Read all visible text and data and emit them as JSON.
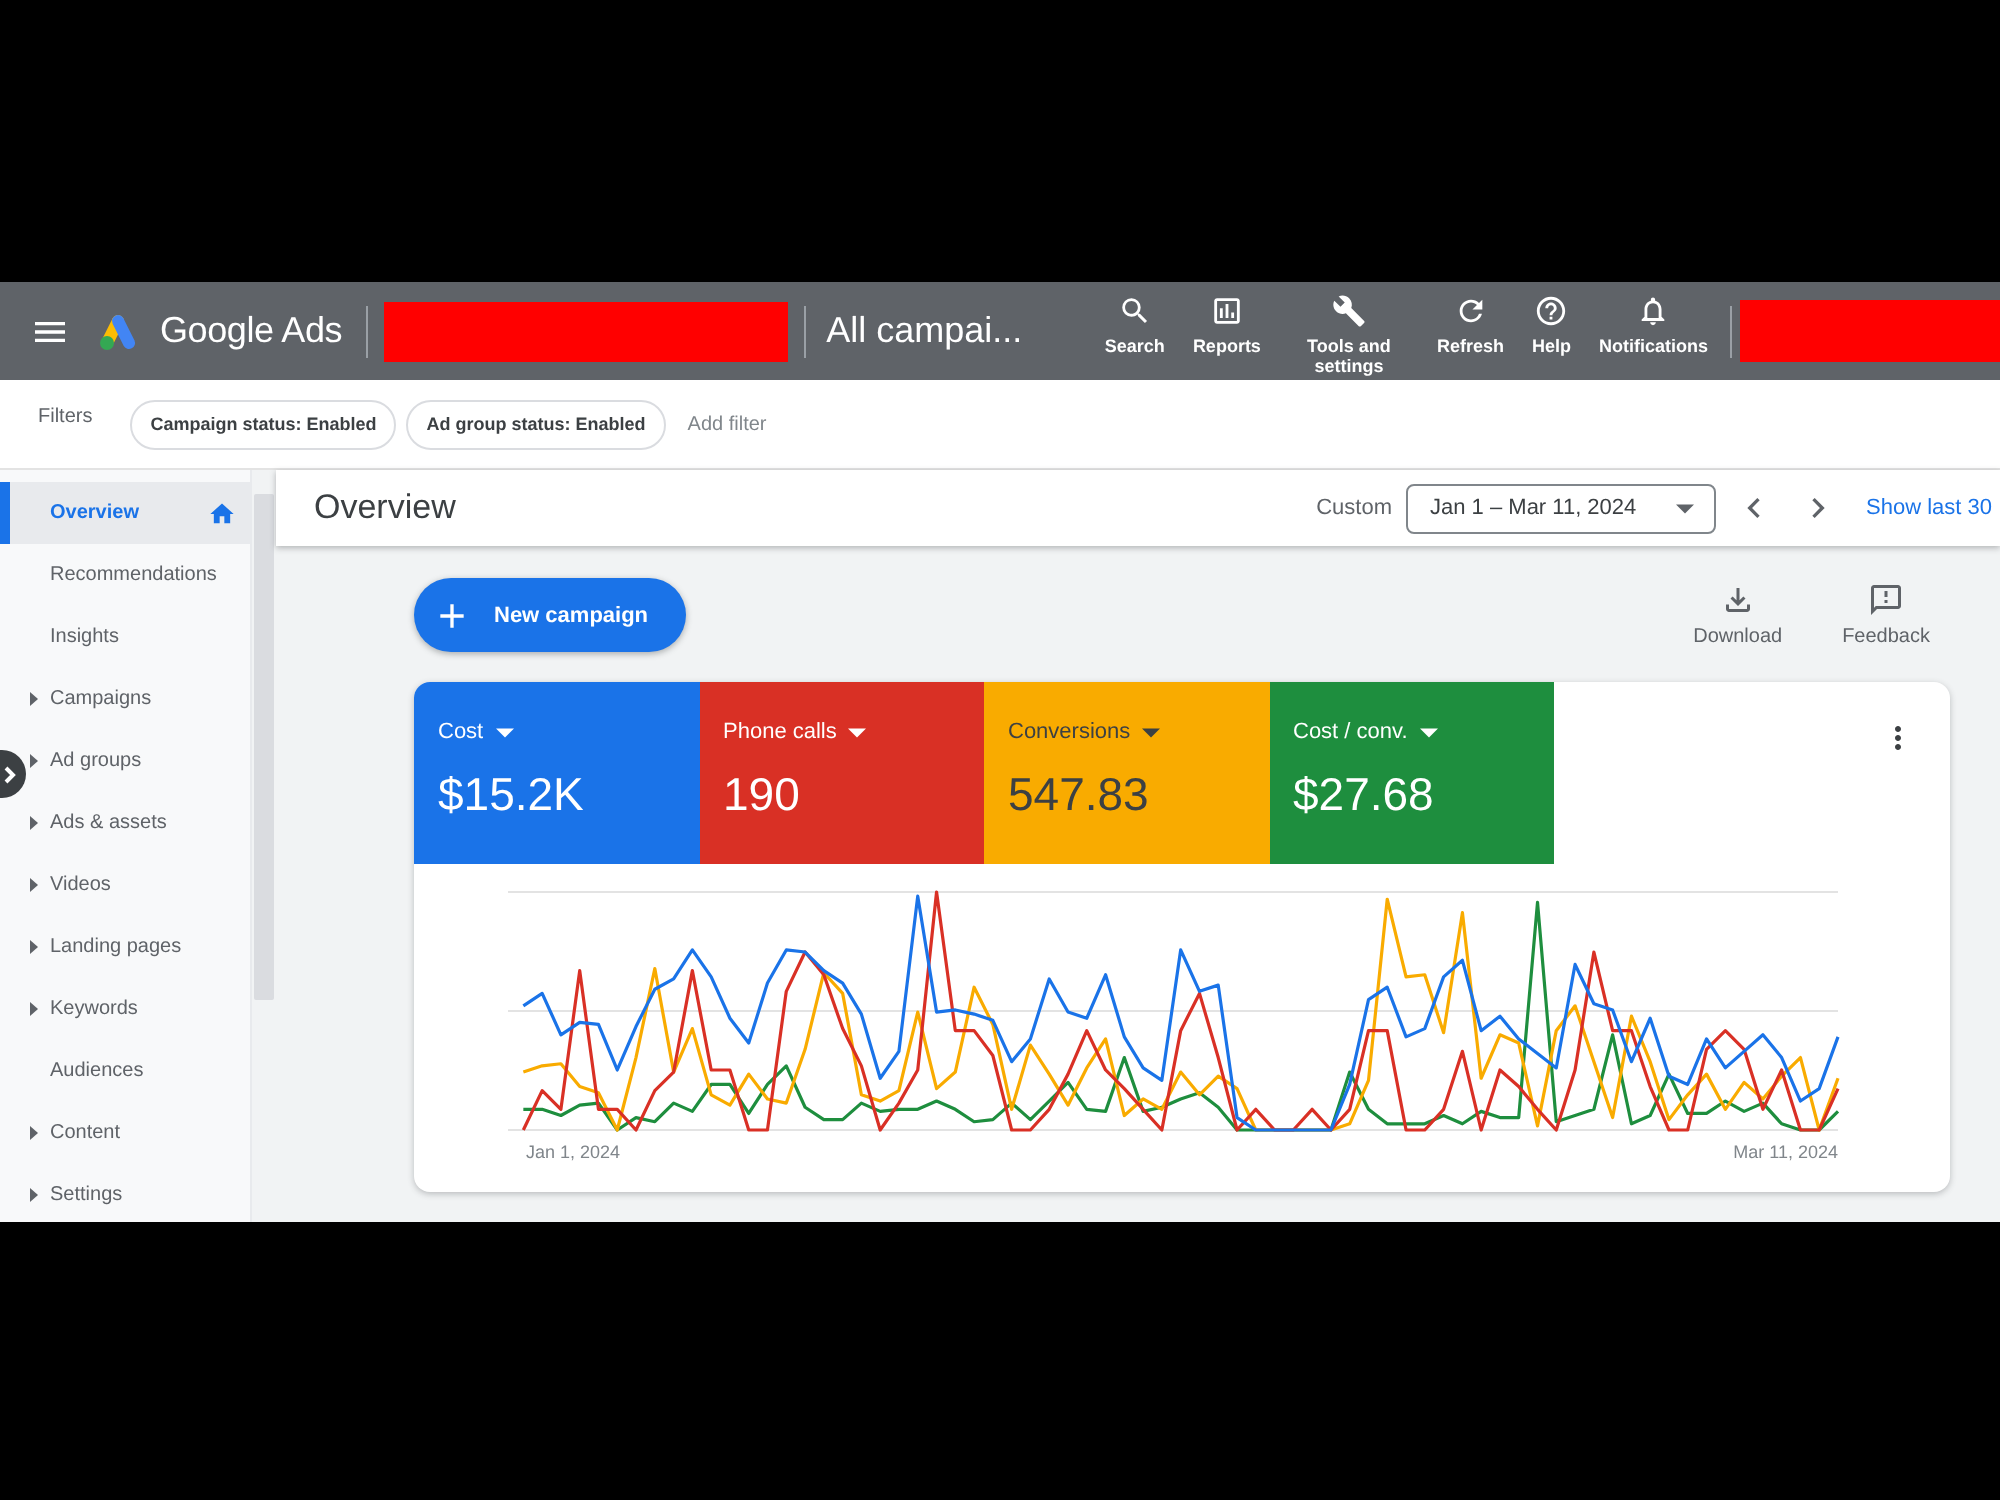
{
  "top_bar": {
    "product": "Google Ads",
    "view_title": "All campai...",
    "actions": [
      "Search",
      "Reports",
      "Tools and settings",
      "Refresh",
      "Help",
      "Notifications"
    ]
  },
  "filters": {
    "label": "Filters",
    "chips": [
      "Campaign status: Enabled",
      "Ad group status: Enabled"
    ],
    "add_label": "Add filter"
  },
  "sidebar": {
    "items": [
      {
        "label": "Overview",
        "kind": "home",
        "selected": true
      },
      {
        "label": "Recommendations",
        "kind": "link",
        "selected": false
      },
      {
        "label": "Insights",
        "kind": "link",
        "selected": false
      },
      {
        "label": "Campaigns",
        "kind": "group",
        "selected": false
      },
      {
        "label": "Ad groups",
        "kind": "group",
        "selected": false
      },
      {
        "label": "Ads & assets",
        "kind": "group",
        "selected": false
      },
      {
        "label": "Videos",
        "kind": "group",
        "selected": false
      },
      {
        "label": "Landing pages",
        "kind": "group",
        "selected": false
      },
      {
        "label": "Keywords",
        "kind": "group",
        "selected": false
      },
      {
        "label": "Audiences",
        "kind": "link",
        "selected": false
      },
      {
        "label": "Content",
        "kind": "group",
        "selected": false
      },
      {
        "label": "Settings",
        "kind": "group",
        "selected": false
      }
    ]
  },
  "header": {
    "title": "Overview",
    "range_type": "Custom",
    "date_range": "Jan 1 – Mar 11, 2024",
    "shortcut": "Show last 30"
  },
  "toolbar": {
    "new_campaign": "New campaign",
    "actions": [
      "Download",
      "Feedback"
    ]
  },
  "metrics": [
    {
      "label": "Cost",
      "value": "$15.2K",
      "color": "#1a73e8"
    },
    {
      "label": "Phone calls",
      "value": "190",
      "color": "#d93025"
    },
    {
      "label": "Conversions",
      "value": "547.83",
      "color": "#f9ab00"
    },
    {
      "label": "Cost / conv.",
      "value": "$27.68",
      "color": "#1e8e3e"
    }
  ],
  "chart": {
    "start_label": "Jan 1, 2024",
    "end_label": "Mar 11, 2024"
  }
}
